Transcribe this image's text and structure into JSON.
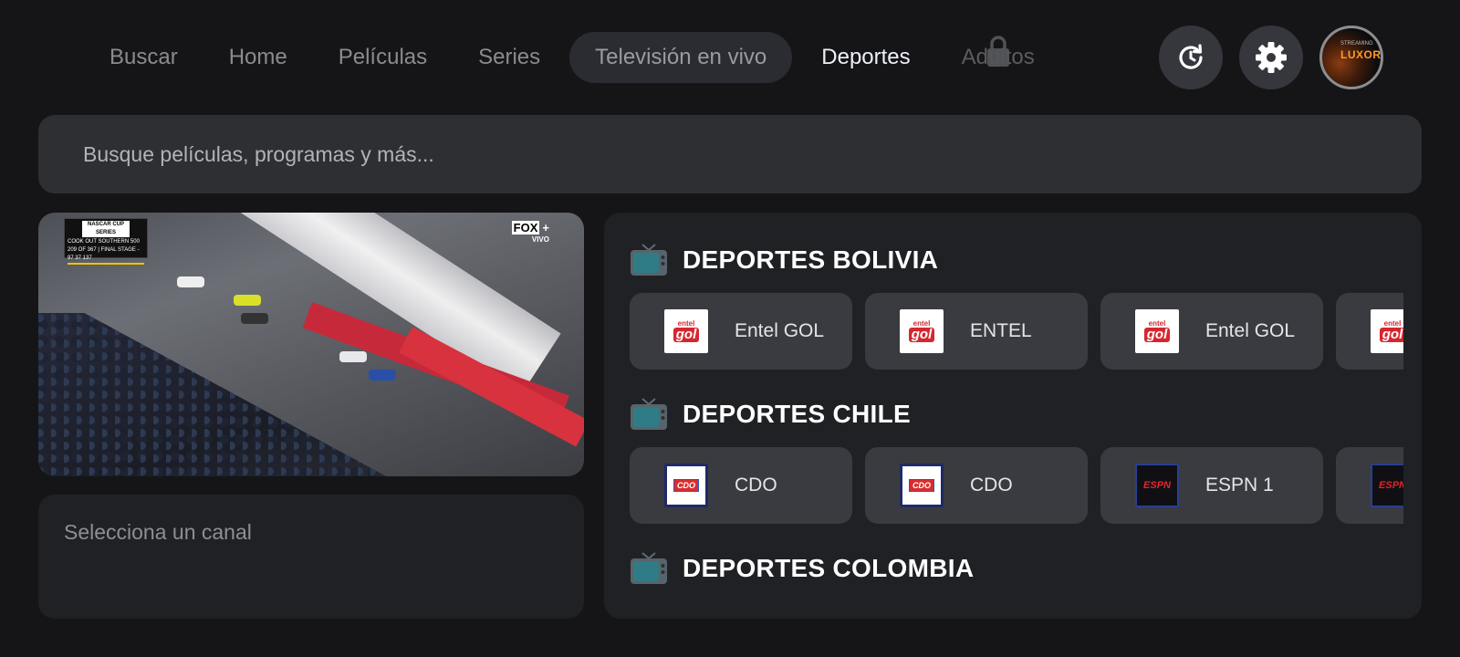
{
  "nav": {
    "items": [
      {
        "label": "Buscar"
      },
      {
        "label": "Home"
      },
      {
        "label": "Películas"
      },
      {
        "label": "Series"
      },
      {
        "label": "Televisión en vivo"
      },
      {
        "label": "Deportes"
      },
      {
        "label": "Adultos"
      }
    ],
    "active_index": 4,
    "current_index": 5,
    "locked_index": 6
  },
  "header_actions": {
    "history_icon": "history-icon",
    "settings_icon": "gear-icon",
    "avatar_label": "LUXOR",
    "avatar_small": "STREAMING"
  },
  "search": {
    "placeholder": "Busque películas, programas y más..."
  },
  "player": {
    "overlay_title": "NASCAR CUP SERIES",
    "overlay_event": "COOK OUT SOUTHERN 500",
    "overlay_status": "209 OF 367 | FINAL STAGE - 97 37 137",
    "network_logo": "FOX",
    "network_live": "VIVO"
  },
  "channel_info": {
    "placeholder": "Selecciona un canal"
  },
  "groups": [
    {
      "title": "DEPORTES BOLIVIA",
      "channels": [
        {
          "label": "Entel GOL",
          "logo": "entel-gol"
        },
        {
          "label": "ENTEL",
          "logo": "entel-gol"
        },
        {
          "label": "Entel GOL",
          "logo": "entel-gol"
        },
        {
          "label": "",
          "logo": "entel-gol"
        }
      ]
    },
    {
      "title": "DEPORTES CHILE",
      "channels": [
        {
          "label": "CDO",
          "logo": "cdo"
        },
        {
          "label": "CDO",
          "logo": "cdo"
        },
        {
          "label": "ESPN 1",
          "logo": "espn"
        },
        {
          "label": "",
          "logo": "espn"
        }
      ]
    },
    {
      "title": "DEPORTES COLOMBIA",
      "channels": []
    }
  ],
  "logo_text": {
    "entel_top": "entel",
    "entel_main": "gol",
    "cdo": "CDO",
    "espn": "ESPN"
  },
  "colors": {
    "background": "#151517",
    "panel": "#202124",
    "card": "#3a3b40",
    "active_pill": "#2a2c31",
    "entel_red": "#d6262f",
    "espn_red": "#e0262c"
  }
}
